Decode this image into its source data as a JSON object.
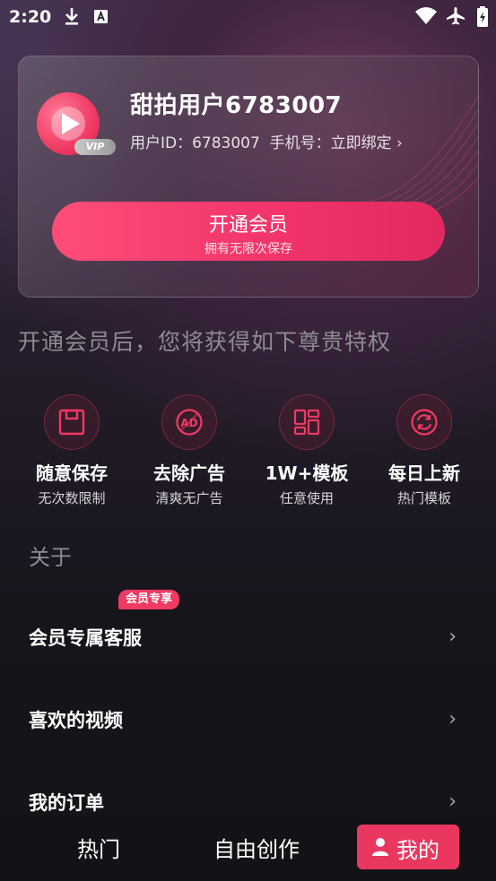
{
  "status_bar": {
    "time": "2:20"
  },
  "profile": {
    "username": "甜拍用户6783007",
    "user_id_label": "用户ID：6783007",
    "phone_label": "手机号：立即绑定",
    "vip_badge": "VIP"
  },
  "vip_button": {
    "title": "开通会员",
    "subtitle": "拥有无限次保存"
  },
  "privileges": {
    "title": "开通会员后，您将获得如下尊贵特权",
    "items": [
      {
        "icon": "save-icon",
        "title": "随意保存",
        "subtitle": "无次数限制"
      },
      {
        "icon": "no-ads-icon",
        "title": "去除广告",
        "subtitle": "清爽无广告"
      },
      {
        "icon": "template-icon",
        "title": "1W+模板",
        "subtitle": "任意使用"
      },
      {
        "icon": "refresh-icon",
        "title": "每日上新",
        "subtitle": "热门模板"
      }
    ]
  },
  "about": {
    "title": "关于",
    "items": [
      {
        "label": "会员专属客服",
        "tag": "会员专享"
      },
      {
        "label": "喜欢的视频"
      },
      {
        "label": "我的订单"
      }
    ]
  },
  "tabs": [
    {
      "label": "热门"
    },
    {
      "label": "自由创作"
    },
    {
      "label": "我的",
      "active": true
    }
  ],
  "colors": {
    "accent": "#f03a64",
    "background": "#17151c"
  }
}
